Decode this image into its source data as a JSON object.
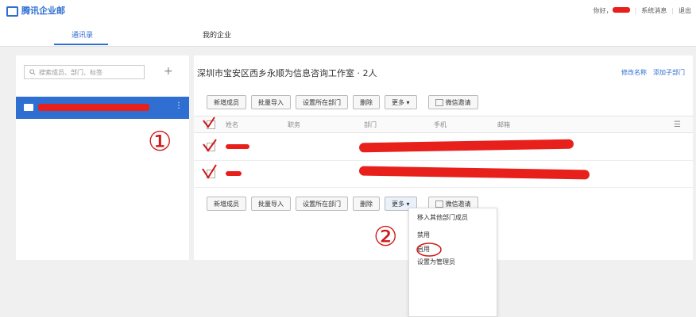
{
  "header": {
    "app_name": "腾讯企业邮",
    "greeting": "你好，",
    "system_messages": "系统消息",
    "logout": "退出",
    "sep": "|"
  },
  "nav": {
    "tabs": [
      "通讯录",
      "我的企业"
    ]
  },
  "sidebar": {
    "search_placeholder": "搜索成员、部门、标签",
    "add_symbol": "+",
    "more_symbol": "⋮"
  },
  "main": {
    "org_title": "深圳市宝安区西乡永顺为信息咨询工作室 · 2人",
    "rename_link": "修改名称",
    "add_subdept_link": "添加子部门",
    "toolbar": {
      "add_member": "新增成员",
      "batch_import": "批量导入",
      "set_department": "设置所在部门",
      "delete": "删除",
      "more": "更多 ▾",
      "wechat_invite": "微信邀请"
    },
    "columns": [
      "姓名",
      "职务",
      "部门",
      "手机",
      "邮箱"
    ],
    "more_menu": [
      "移入其他部门成员",
      "禁用",
      "启用",
      "设置为管理员"
    ]
  },
  "annotations": {
    "circle_1": "①",
    "circle_2": "②"
  },
  "colors": {
    "accent": "#2e6fd1",
    "redaction": "#e8201c",
    "ink": "#d01818"
  }
}
